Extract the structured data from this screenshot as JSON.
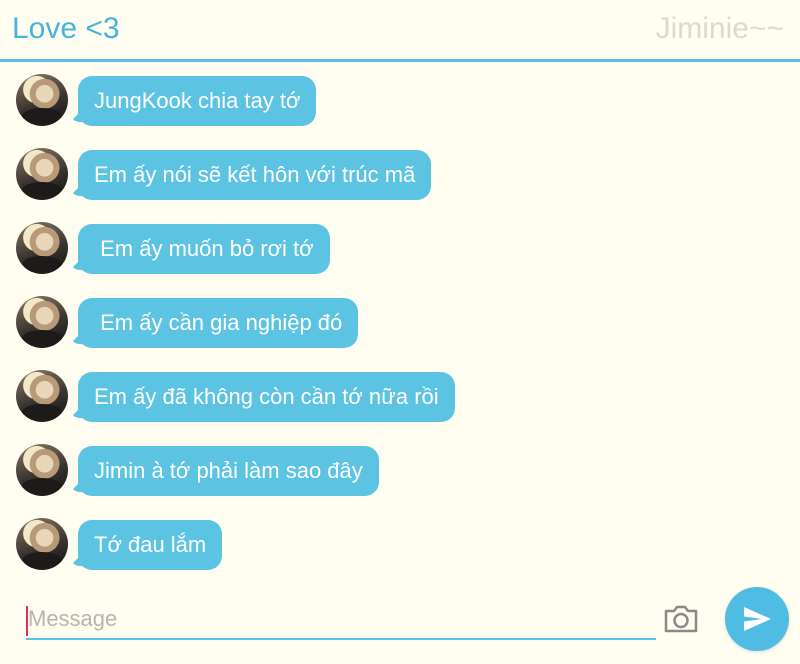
{
  "header": {
    "title": "Love <3",
    "contact_name": "Jiminie~~"
  },
  "messages": [
    {
      "text": "JungKook chia tay tớ"
    },
    {
      "text": "Em ấy nói sẽ kết hôn với trúc mã"
    },
    {
      "text": " Em ấy muốn bỏ rơi tớ"
    },
    {
      "text": " Em ấy cần gia nghiệp đó"
    },
    {
      "text": "Em ấy đã không còn cần tớ nữa rồi"
    },
    {
      "text": "Jimin à tớ phải làm sao đây"
    },
    {
      "text": "Tớ đau lắm"
    }
  ],
  "composer": {
    "placeholder": "Message",
    "camera_icon": "camera-icon",
    "send_icon": "send-icon"
  },
  "colors": {
    "accent": "#5bc2e5",
    "bubble": "#5cc3e3",
    "background": "#fffef0",
    "title": "#45b3de",
    "contact_name": "#d8dbd2"
  }
}
